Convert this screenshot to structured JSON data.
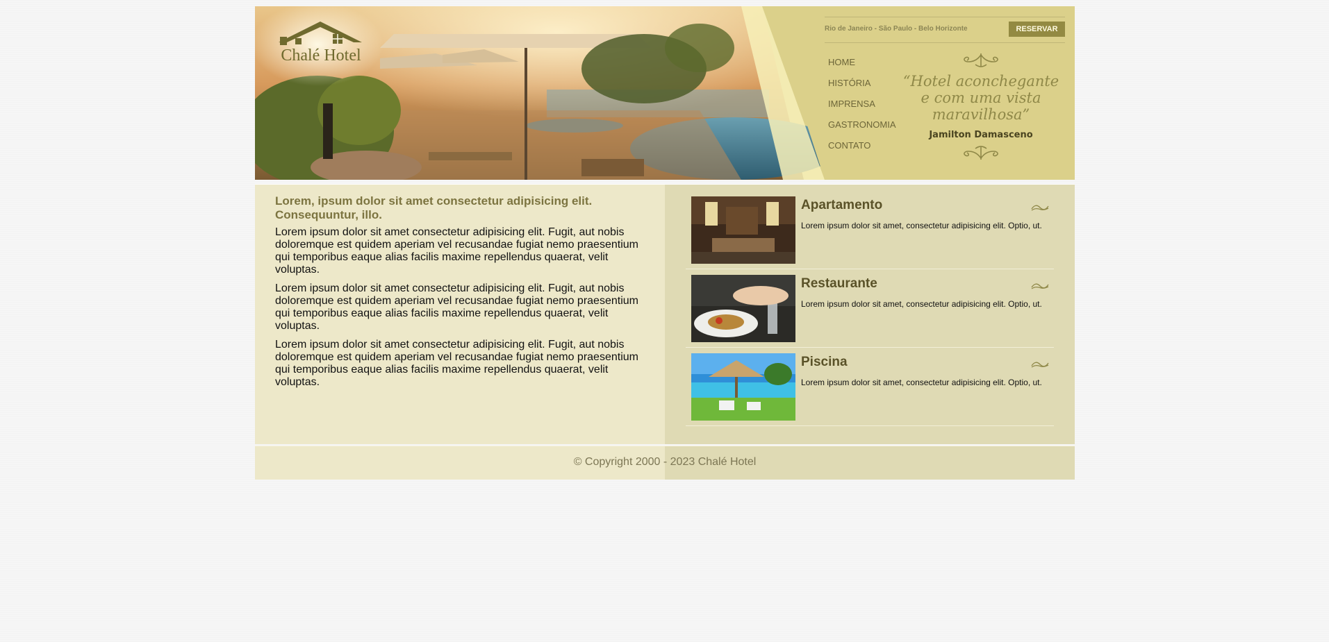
{
  "brand": {
    "name": "Chalé Hotel"
  },
  "header": {
    "cities": "Rio de Janeiro - São Paulo - Belo Horizonte",
    "reserve_label": "RESERVAR"
  },
  "nav": {
    "items": [
      "HOME",
      "HISTÓRIA",
      "IMPRENSA",
      "GASTRONOMIA",
      "CONTATO"
    ]
  },
  "quote": {
    "text": "“Hotel aconchegante e com uma vista maravilhosa”",
    "author": "Jamilton Damasceno"
  },
  "main": {
    "title": "Lorem, ipsum dolor sit amet consectetur adipisicing elit. Consequuntur, illo.",
    "paragraphs": [
      "Lorem ipsum dolor sit amet consectetur adipisicing elit. Fugit, aut nobis doloremque est quidem aperiam vel recusandae fugiat nemo praesentium qui temporibus eaque alias facilis maxime repellendus quaerat, velit voluptas.",
      "Lorem ipsum dolor sit amet consectetur adipisicing elit. Fugit, aut nobis doloremque est quidem aperiam vel recusandae fugiat nemo praesentium qui temporibus eaque alias facilis maxime repellendus quaerat, velit voluptas.",
      "Lorem ipsum dolor sit amet consectetur adipisicing elit. Fugit, aut nobis doloremque est quidem aperiam vel recusandae fugiat nemo praesentium qui temporibus eaque alias facilis maxime repellendus quaerat, velit voluptas."
    ]
  },
  "services": [
    {
      "title": "Apartamento",
      "description": "Lorem ipsum dolor sit amet, consectetur adipisicing elit. Optio, ut.",
      "icon": "ornament-icon"
    },
    {
      "title": "Restaurante",
      "description": "Lorem ipsum dolor sit amet, consectetur adipisicing elit. Optio, ut.",
      "icon": "ornament-icon"
    },
    {
      "title": "Piscina",
      "description": "Lorem ipsum dolor sit amet, consectetur adipisicing elit. Optio, ut.",
      "icon": "ornament-icon"
    }
  ],
  "footer": {
    "copyright": "© Copyright 2000 - 2023 Chalé Hotel"
  },
  "colors": {
    "header_bg": "#dbd08a",
    "accent": "#938a42",
    "left_panel": "#ede8c9",
    "right_panel": "#dfdab4",
    "title": "#7c7440"
  }
}
